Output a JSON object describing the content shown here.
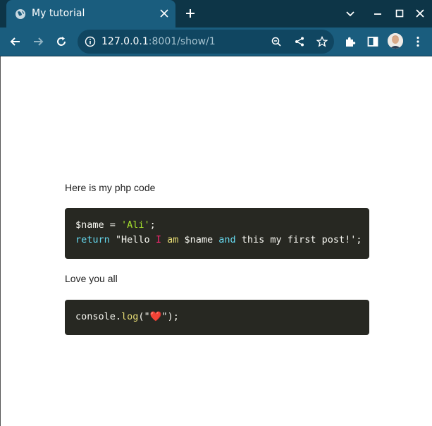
{
  "browser": {
    "tab_title": "My tutorial",
    "url_host": "127.0.0.1",
    "url_rest": ":8001/show/1"
  },
  "page": {
    "paragraph1": "Here is my php code",
    "code1": {
      "line1": {
        "var": "$name",
        "op": " = ",
        "str": "'Ali'",
        "end": ";"
      },
      "line2": {
        "kw": "return",
        "p1": " \"Hello ",
        "i": "I",
        "sp1": " ",
        "am": "am",
        "p2": " $name ",
        "and": "and",
        "p3": " this my first post!';"
      }
    },
    "paragraph2": "Love you all",
    "code2": {
      "obj": "console.",
      "fn": "log",
      "open": "(\"",
      "heart": "❤️",
      "close": "\");"
    }
  }
}
